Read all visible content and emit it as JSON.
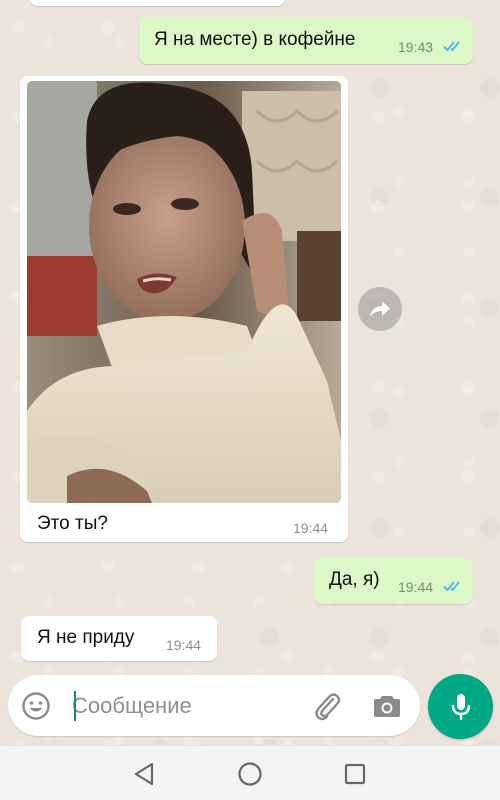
{
  "colors": {
    "outgoing_bubble": "#dcf8c6",
    "incoming_bubble": "#ffffff",
    "accent_green": "#00a884",
    "read_ticks": "#4fb6ec"
  },
  "messages": [
    {
      "direction": "out",
      "text": "Я на месте) в кофейне",
      "time": "19:43",
      "status": "read"
    },
    {
      "direction": "in",
      "type": "photo",
      "caption": "Это ты?",
      "time": "19:44"
    },
    {
      "direction": "out",
      "text": "Да, я)",
      "time": "19:44",
      "status": "read"
    },
    {
      "direction": "in",
      "text": "Я не приду",
      "time": "19:44"
    }
  ],
  "composer": {
    "placeholder": "Сообщение",
    "emoji_icon": "emoji-icon",
    "attach_icon": "paperclip-icon",
    "camera_icon": "camera-icon",
    "mic_icon": "microphone-icon"
  },
  "navbar": {
    "back_icon": "back-triangle-icon",
    "home_icon": "home-circle-icon",
    "recents_icon": "recents-square-icon"
  }
}
